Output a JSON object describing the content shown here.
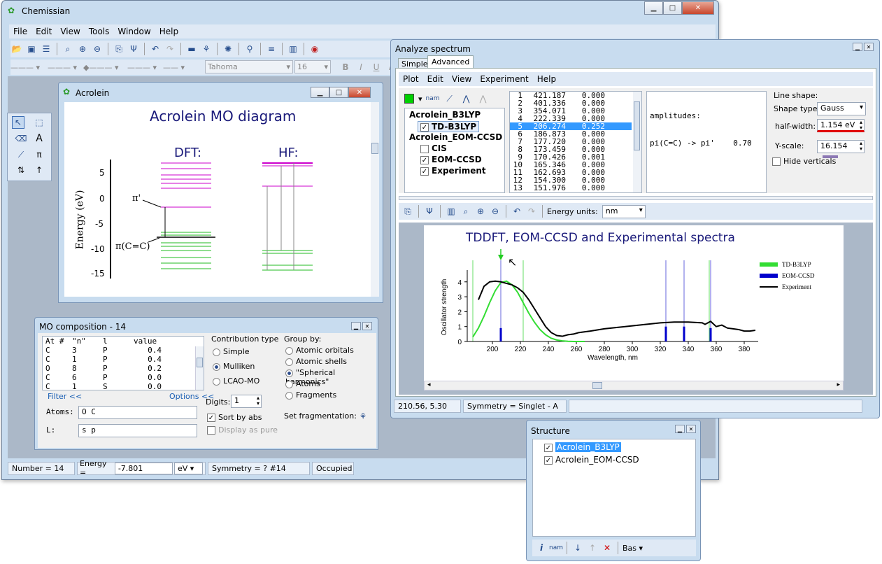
{
  "main": {
    "title": "Chemissian",
    "menu": [
      "File",
      "Edit",
      "View",
      "Tools",
      "Window",
      "Help"
    ],
    "font_name": "Tahoma",
    "font_size": "16"
  },
  "acrolein": {
    "title": "Acrolein",
    "diagram_title": "Acrolein MO diagram",
    "dft_label": "DFT:",
    "hf_label": "HF:",
    "y_axis_label": "Energy (eV)",
    "y_ticks": [
      "5",
      "0",
      "-5",
      "-10",
      "-15"
    ],
    "pi_star_label": "π'",
    "pi_label": "π(C=C)"
  },
  "mo": {
    "title": "MO composition - 14",
    "headers": [
      "At #",
      "\"n\"",
      "l",
      "value"
    ],
    "rows": [
      [
        "C",
        "3",
        "P",
        "0.4"
      ],
      [
        "C",
        "1",
        "P",
        "0.4"
      ],
      [
        "O",
        "8",
        "P",
        "0.2"
      ],
      [
        "C",
        "6",
        "P",
        "0.0"
      ],
      [
        "C",
        "1",
        "S",
        "0.0"
      ]
    ],
    "filter_link": "Filter <<",
    "options_link": "Options <<",
    "atoms_label": "Atoms:",
    "atoms_value": "O C",
    "l_label": "L:",
    "l_value": "s p",
    "contribution_title": "Contribution type",
    "contribution": [
      "Simple",
      "Mulliken",
      "LCAO-MO"
    ],
    "group_title": "Group by:",
    "group": [
      "Atomic orbitals",
      "Atomic shells",
      "\"Spherical harmonics\"",
      "Atoms",
      "Fragments"
    ],
    "digits_label": "Digits:",
    "digits_value": "1",
    "sort_by_abs": "Sort by abs",
    "display_pure": "Display as pure",
    "set_fragmentation": "Set fragmentation:"
  },
  "main_status": {
    "number": "Number = 14",
    "energy_label": "Energy =",
    "energy_value": "-7.801",
    "energy_unit": "eV",
    "symmetry": "Symmetry = ? #14",
    "occupied": "Occupied"
  },
  "analyze": {
    "title": "Analyze spectrum",
    "tabs": [
      "Simple",
      "Advanced"
    ],
    "menu": [
      "Plot",
      "Edit",
      "View",
      "Experiment",
      "Help"
    ],
    "tree": {
      "group1": "Acrolein_B3LYP",
      "item1": "TD-B3LYP",
      "group2": "Acrolein_EOM-CCSD",
      "items2": [
        "CIS",
        "EOM-CCSD",
        "Experiment"
      ]
    },
    "table": [
      [
        "1",
        "421.187",
        "0.000"
      ],
      [
        "2",
        "401.336",
        "0.000"
      ],
      [
        "3",
        "354.071",
        "0.000"
      ],
      [
        "4",
        "222.339",
        "0.000"
      ],
      [
        "5",
        "206.274",
        "0.252"
      ],
      [
        "6",
        "186.873",
        "0.000"
      ],
      [
        "7",
        "177.720",
        "0.000"
      ],
      [
        "8",
        "173.459",
        "0.000"
      ],
      [
        "9",
        "170.426",
        "0.001"
      ],
      [
        "10",
        "165.346",
        "0.000"
      ],
      [
        "11",
        "162.693",
        "0.000"
      ],
      [
        "12",
        "154.300",
        "0.000"
      ],
      [
        "13",
        "151.976",
        "0.000"
      ]
    ],
    "amplitudes_line1": "amplitudes:",
    "amplitudes_line2": "pi(C=C) -> pi'    0.70",
    "line_shape_title": "Line shape:",
    "shape_type_label": "Shape type:",
    "shape_type_value": "Gauss",
    "half_width_label": "half-width:",
    "half_width_value": "1.154 eV",
    "y_scale_label": "Y-scale:",
    "y_scale_value": "16.154",
    "hide_verticals": "Hide verticals",
    "energy_units_label": "Energy units:",
    "energy_units_value": "nm",
    "status_coords": "210.56,  5.30",
    "status_symmetry": "Symmetry = Singlet - A"
  },
  "structure": {
    "title": "Structure",
    "items": [
      "Acrolein_B3LYP",
      "Acrolein_EOM-CCSD"
    ],
    "bas_button": "Bas"
  },
  "chart_data": {
    "type": "line",
    "title": "TDDFT, EOM-CCSD and Experimental spectra",
    "xlabel": "Wavelength, nm",
    "ylabel": "Oscillator strength",
    "xlim": [
      182,
      390
    ],
    "ylim": [
      0,
      4.6
    ],
    "xticks": [
      200,
      220,
      240,
      260,
      280,
      300,
      320,
      340,
      360,
      380
    ],
    "yticks": [
      0,
      1,
      2,
      3,
      4
    ],
    "legend_position": "top-right",
    "series": [
      {
        "name": "TD-B3LYP",
        "color": "#33dd33",
        "x": [
          186,
          190,
          194,
          198,
          202,
          206,
          210,
          214,
          218,
          222,
          226,
          230,
          234,
          238,
          242,
          246,
          250,
          254,
          258,
          262,
          266
        ],
        "y": [
          0.3,
          0.9,
          1.7,
          2.6,
          3.4,
          3.95,
          4.05,
          3.8,
          3.3,
          2.6,
          1.9,
          1.3,
          0.8,
          0.45,
          0.22,
          0.1,
          0.04,
          0.01,
          0,
          0,
          0
        ]
      },
      {
        "name": "EOM-CCSD",
        "color": "#0000cc",
        "sticks": [
          [
            206,
            0.9
          ],
          [
            324,
            1.0
          ],
          [
            337,
            1.0
          ],
          [
            356,
            0.9
          ]
        ]
      },
      {
        "name": "Experiment",
        "color": "#000000",
        "x": [
          190,
          194,
          198,
          202,
          206,
          210,
          214,
          218,
          222,
          226,
          230,
          234,
          238,
          242,
          246,
          250,
          254,
          258,
          262,
          270,
          280,
          290,
          300,
          310,
          320,
          330,
          340,
          350,
          352,
          356,
          360,
          364,
          368,
          372,
          376,
          380,
          384,
          388
        ],
        "y": [
          2.8,
          3.7,
          4.0,
          4.05,
          4.0,
          3.9,
          3.8,
          3.6,
          3.3,
          2.8,
          2.2,
          1.6,
          1.0,
          0.6,
          0.4,
          0.35,
          0.45,
          0.5,
          0.6,
          0.7,
          0.85,
          0.95,
          1.05,
          1.15,
          1.25,
          1.3,
          1.3,
          1.25,
          1.15,
          1.35,
          1.0,
          1.1,
          0.9,
          0.85,
          0.8,
          0.7,
          0.7,
          0.75
        ]
      }
    ],
    "green_lines_x": [
      186,
      206,
      222,
      355
    ],
    "blue_lines_x": [
      206,
      324,
      337,
      356
    ]
  }
}
